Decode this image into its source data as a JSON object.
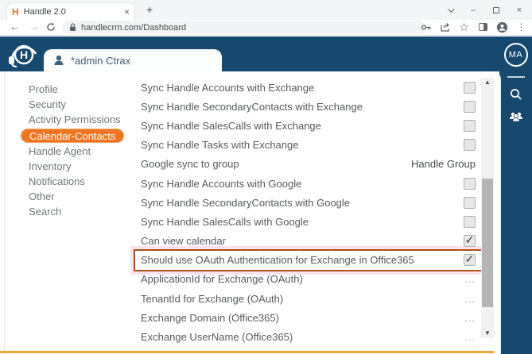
{
  "browser": {
    "favicon_letter": "H",
    "tab_title": "Handle 2.0",
    "url": "handlecrm.com/Dashboard"
  },
  "icons": {
    "close": "×",
    "plus": "+",
    "minimize": "–",
    "back": "←",
    "forward": "→",
    "star": "☆",
    "kebab": "⋮",
    "check": "✓",
    "up": "▲",
    "down": "▼"
  },
  "app": {
    "logo_letter": "H",
    "user_tab_label": "*admin Ctrax",
    "avatar_initials": "MA",
    "navy_color": "#17486d",
    "accent_orange": "#ee7623",
    "highlight_border_color": "#a9511d",
    "bottom_bar_color": "#f2a33c"
  },
  "sidebar": {
    "items": [
      {
        "label": "Profile",
        "active": false
      },
      {
        "label": "Security",
        "active": false
      },
      {
        "label": "Activity Permissions",
        "active": false
      },
      {
        "label": "Calendar-Contacts",
        "active": true
      },
      {
        "label": "Handle Agent",
        "active": false
      },
      {
        "label": "Inventory",
        "active": false
      },
      {
        "label": "Notifications",
        "active": false
      },
      {
        "label": "Other",
        "active": false
      },
      {
        "label": "Search",
        "active": false
      }
    ]
  },
  "settings": {
    "rows": [
      {
        "label": "Sync Handle Accounts with Exchange",
        "type": "checkbox",
        "checked": false
      },
      {
        "label": "Sync Handle SecondaryContacts with Exchange",
        "type": "checkbox",
        "checked": false
      },
      {
        "label": "Sync Handle SalesCalls with Exchange",
        "type": "checkbox",
        "checked": false
      },
      {
        "label": "Sync Handle Tasks with Exchange",
        "type": "checkbox",
        "checked": false
      },
      {
        "label": "Google sync to group",
        "type": "text",
        "value": "Handle Group"
      },
      {
        "label": "Sync Handle Accounts with Google",
        "type": "checkbox",
        "checked": false
      },
      {
        "label": "Sync Handle SecondaryContacts with Google",
        "type": "checkbox",
        "checked": false
      },
      {
        "label": "Sync Handle SalesCalls with Google",
        "type": "checkbox",
        "checked": false
      },
      {
        "label": "Can view calendar",
        "type": "checkbox",
        "checked": true
      },
      {
        "label": "Should use OAuth Authentication for Exchange in Office365",
        "type": "checkbox",
        "checked": true,
        "highlighted": true
      },
      {
        "label": "ApplicationId for Exchange (OAuth)",
        "type": "text",
        "value": "...",
        "dots": true
      },
      {
        "label": "TenantId for Exchange (OAuth)",
        "type": "text",
        "value": "...",
        "dots": true
      },
      {
        "label": "Exchange Domain (Office365)",
        "type": "text",
        "value": "...",
        "dots": true
      },
      {
        "label": "Exchange UserName (Office365)",
        "type": "text",
        "value": "...",
        "dots": true,
        "muted": true
      }
    ]
  }
}
